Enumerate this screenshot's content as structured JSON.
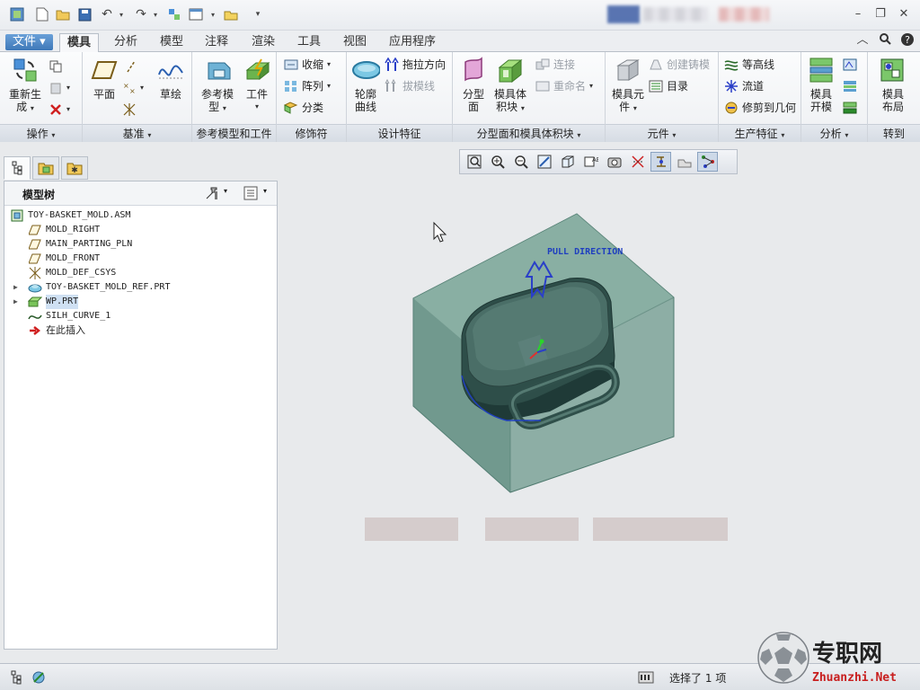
{
  "menu": {
    "file": "文件",
    "tabs": [
      "模具",
      "分析",
      "模型",
      "注释",
      "渲染",
      "工具",
      "视图",
      "应用程序"
    ]
  },
  "ribbon": {
    "operations": {
      "label": "操作",
      "regenerate": "重新生成",
      "regen_line1": "重新生",
      "regen_line2": "成"
    },
    "datum": {
      "label": "基准",
      "plane": "平面",
      "sketch": "草绘"
    },
    "refmodel": {
      "label": "参考模型和工件",
      "refmodel_line1": "参考模",
      "refmodel_line2": "型",
      "workpiece": "工件"
    },
    "modifiers": {
      "label": "修饰符",
      "shrink": "收缩",
      "pattern": "阵列",
      "classify": "分类"
    },
    "design": {
      "label": "设计特征",
      "silhouette_line1": "轮廓",
      "silhouette_line2": "曲线",
      "pull_direction": "拖拉方向",
      "draft_line": "拔模线"
    },
    "parting": {
      "label": "分型面和模具体积块",
      "parting_line1": "分型",
      "parting_line2": "面",
      "volume_line1": "模具体",
      "volume_line2": "积块",
      "connect": "连接",
      "rename": "重命名"
    },
    "components": {
      "label": "元件",
      "mold_comp_line1": "模具元",
      "mold_comp_line2": "件",
      "create_casting": "创建铸模",
      "catalog": "目录"
    },
    "production": {
      "label": "生产特征",
      "contour": "等高线",
      "runner": "流道",
      "trim_geom": "修剪到几何"
    },
    "analysis": {
      "label": "分析",
      "mold_open_line1": "模具",
      "mold_open_line2": "开模"
    },
    "goto": {
      "label": "转到",
      "layout_line1": "模具",
      "layout_line2": "布局"
    }
  },
  "tree": {
    "title": "模型树",
    "items": [
      {
        "name": "TOY-BASKET_MOLD.ASM",
        "icon": "assembly-icon"
      },
      {
        "name": "MOLD_RIGHT",
        "icon": "datum-plane-icon"
      },
      {
        "name": "MAIN_PARTING_PLN",
        "icon": "datum-plane-icon"
      },
      {
        "name": "MOLD_FRONT",
        "icon": "datum-plane-icon"
      },
      {
        "name": "MOLD_DEF_CSYS",
        "icon": "csys-icon"
      },
      {
        "name": "TOY-BASKET_MOLD_REF.PRT",
        "icon": "part-icon"
      },
      {
        "name": "WP.PRT",
        "icon": "workpiece-icon"
      },
      {
        "name": "SILH_CURVE_1",
        "icon": "curve-icon"
      },
      {
        "name": "在此插入",
        "icon": "insert-here-arrow-icon"
      }
    ]
  },
  "viewport": {
    "annotation": "PULL DIRECTION"
  },
  "status": {
    "selected_prefix": "选择了",
    "selected_count": "1",
    "selected_suffix": "项"
  },
  "watermark": {
    "cn": "专职网",
    "url": "Zhuanzhi.Net"
  },
  "colors": {
    "accent": "#3e78b8",
    "workpiece": "#6f9a8e",
    "part": "#3b5e58",
    "pull_arrow": "#2a3fc8"
  }
}
